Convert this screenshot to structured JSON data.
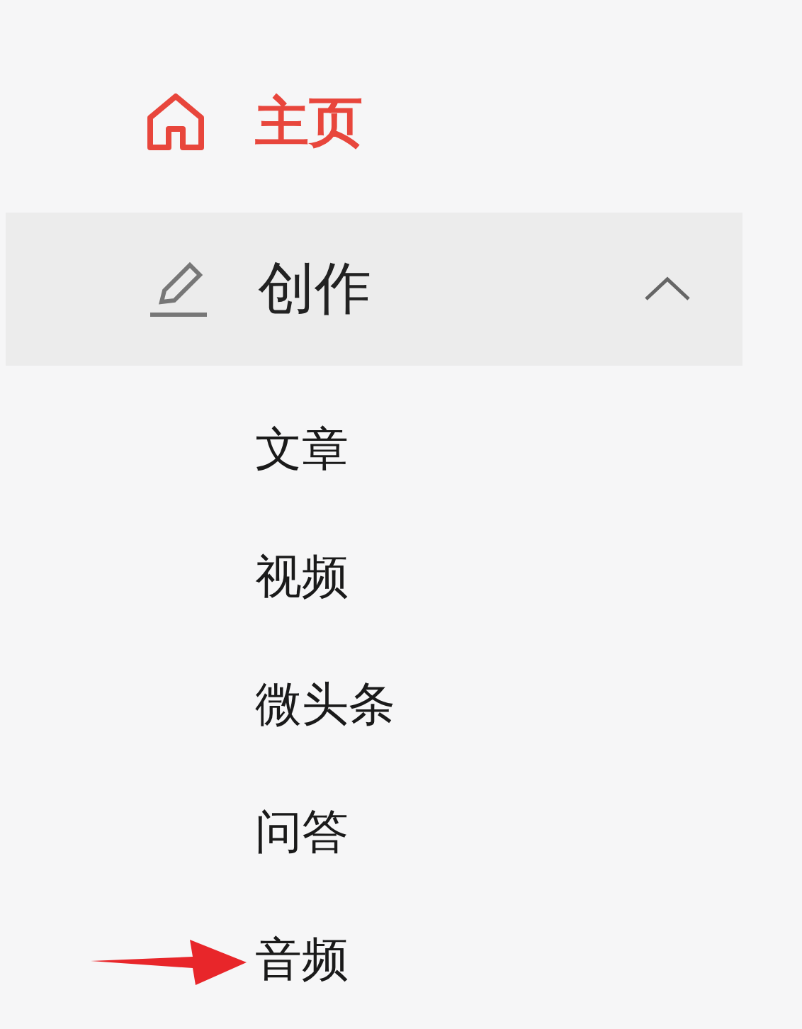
{
  "home": {
    "label": "主页",
    "selected": true
  },
  "section": {
    "label": "创作",
    "selected": false,
    "expanded": true,
    "children": [
      {
        "label": "文章",
        "marked": false
      },
      {
        "label": "视频",
        "marked": false
      },
      {
        "label": "微头条",
        "marked": false
      },
      {
        "label": "问答",
        "marked": false
      },
      {
        "label": "音频",
        "marked": true
      }
    ]
  }
}
